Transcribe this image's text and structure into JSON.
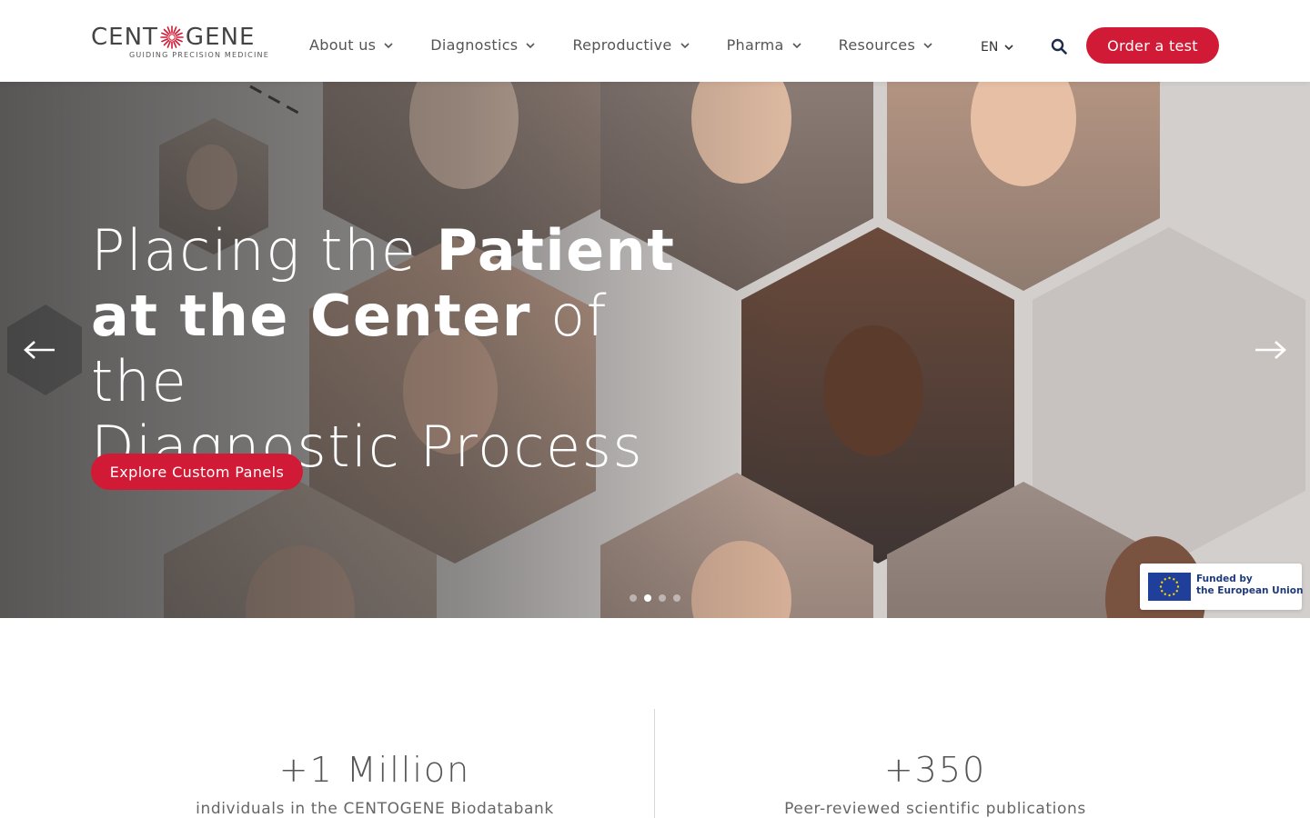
{
  "brand": {
    "name_left": "CENT",
    "name_right": "GENE",
    "tagline": "GUIDING PRECISION MEDICINE",
    "accent": "#d11a35"
  },
  "nav": {
    "items": [
      {
        "label": "About us",
        "icon": "chevron-down-icon"
      },
      {
        "label": "Diagnostics",
        "icon": "chevron-down-icon"
      },
      {
        "label": "Reproductive",
        "icon": "chevron-down-icon"
      },
      {
        "label": "Pharma",
        "icon": "chevron-down-icon"
      },
      {
        "label": "Resources",
        "icon": "chevron-down-icon"
      }
    ],
    "language": "EN",
    "search_icon": "search-icon",
    "order_label": "Order a test"
  },
  "hero": {
    "title_part1": "Placing the ",
    "title_bold1": "Patient",
    "title_bold2": "at the Center",
    "title_part2": " of the",
    "title_part3": "Diagnostic Process",
    "cta_label": "Explore Custom Panels",
    "prev_icon": "arrow-left-icon",
    "next_icon": "arrow-right-icon",
    "slides_total": 4,
    "active_slide": 2,
    "eu_line1": "Funded by",
    "eu_line2": "the European Union"
  },
  "stats": [
    {
      "value": "+1 Million",
      "label": "individuals in the CENTOGENE Biodatabank"
    },
    {
      "value": "+350",
      "label": "Peer-reviewed scientific publications"
    }
  ]
}
